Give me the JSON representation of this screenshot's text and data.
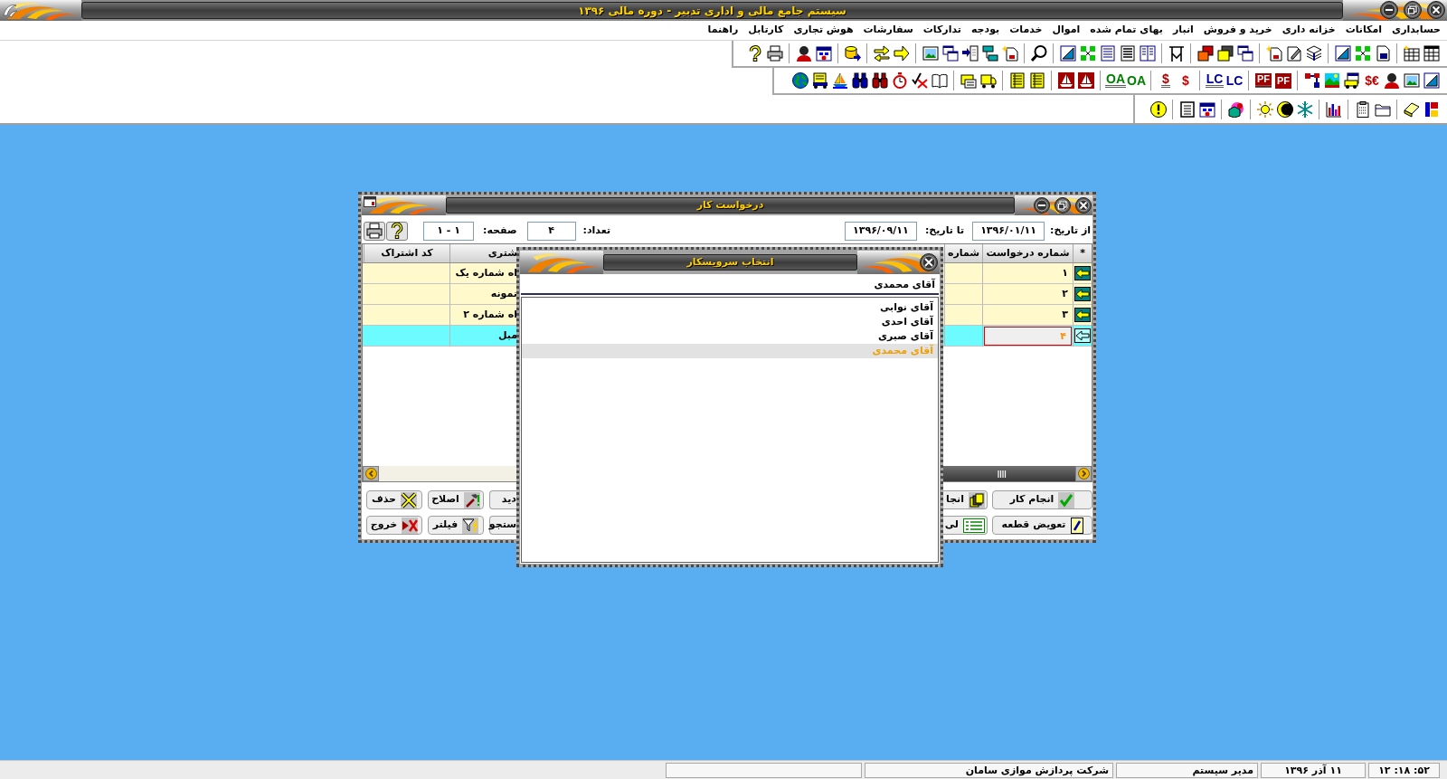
{
  "window": {
    "title": "سیستم جامع مالی و اداری تدبیر - دوره مالی ۱۳۹۶"
  },
  "menu": [
    "حسابداری",
    "امکانات",
    "خزانه داری",
    "خرید و فروش",
    "انبار",
    "بهای تمام شده",
    "اموال",
    "خدمات",
    "بودجه",
    "تدارکات",
    "سفارشات",
    "هوش تجاری",
    "کارتابل",
    "راهنما"
  ],
  "toolbar": {
    "glyph_buttons": [
      {
        "text": "$€",
        "kind": "plain",
        "color": "#c00000"
      },
      {
        "text": "PF",
        "kind": "tile",
        "color": "#a00000"
      },
      {
        "text": "PF",
        "kind": "tile_strip",
        "color": "#a00000"
      },
      {
        "text": "LC",
        "kind": "plain",
        "color": "#0000a0"
      },
      {
        "text": "LC",
        "kind": "strip",
        "color": "#0000a0"
      },
      {
        "text": "$",
        "kind": "plain",
        "color": "#c00000"
      },
      {
        "text": "$",
        "kind": "strip",
        "color": "#a00000"
      },
      {
        "text": "OA",
        "kind": "plain",
        "color": "#008000"
      },
      {
        "text": "OA",
        "kind": "strip",
        "color": "#008000"
      }
    ]
  },
  "dialog": {
    "title": "درخواست کار",
    "filters": [
      {
        "label": "از تاریخ:",
        "value": "۱۳۹۶/۰۱/۱۱"
      },
      {
        "label": "تا تاریخ:",
        "value": "۱۳۹۶/۰۹/۱۱"
      },
      {
        "label": "تعداد:",
        "value": "۴"
      },
      {
        "label": "صفحه:",
        "value": "۱ - ۱"
      }
    ],
    "table": {
      "columns": [
        "*",
        "شماره درخواست",
        "شماره",
        "شتری",
        "کد اشتراک"
      ],
      "rows": [
        {
          "request_number": "۱",
          "column_4": "اه شماره یک",
          "selected": false
        },
        {
          "request_number": "۲",
          "column_4": "نمونه",
          "selected": false
        },
        {
          "request_number": "۳",
          "column_4": "اه شماره ۲",
          "selected": false
        },
        {
          "request_number": "۴",
          "column_4": "مبل",
          "selected": true
        }
      ]
    },
    "buttons": [
      [
        "انجام کار",
        "انجا",
        "دید",
        "اصلاح",
        "حذف"
      ],
      [
        "تعویض قطعه",
        "لی",
        "ستجو",
        "فیلتر",
        "خروج"
      ]
    ]
  },
  "popup": {
    "title": "انتخاب سرویسکار",
    "value": "آقای محمدی",
    "options": [
      {
        "label": "آقای نوابی",
        "selected": false
      },
      {
        "label": "آقای احدی",
        "selected": false
      },
      {
        "label": "آقای صبری",
        "selected": false
      },
      {
        "label": "آقای محمدی",
        "selected": true
      }
    ]
  },
  "status_bar": {
    "time": "۱۲ :۱۸ :۵۲",
    "date": "۱۱ آذر ۱۳۹۶",
    "user": "مدیر سیستم",
    "company": "شرکت پردازش موازی سامان"
  }
}
